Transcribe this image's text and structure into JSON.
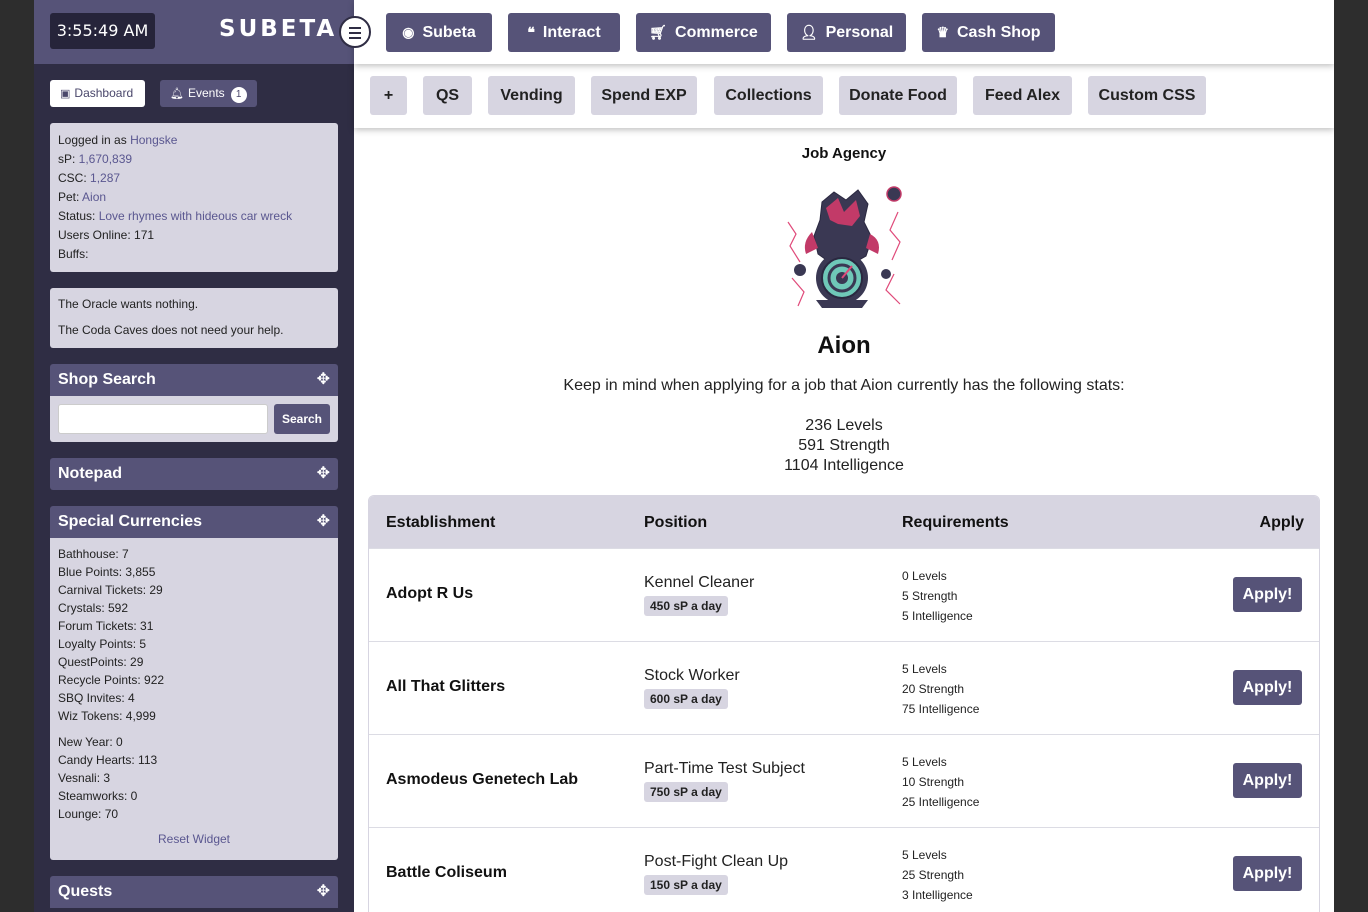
{
  "header": {
    "clock": "3:55:49 AM",
    "logo": "SUBETA"
  },
  "nav": [
    {
      "label": "Subeta",
      "icon": "compass-icon"
    },
    {
      "label": "Interact",
      "icon": "chat-bubbles-icon"
    },
    {
      "label": "Commerce",
      "icon": "cart-icon"
    },
    {
      "label": "Personal",
      "icon": "user-icon"
    },
    {
      "label": "Cash Shop",
      "icon": "crown-icon"
    }
  ],
  "subnav": [
    "+",
    "QS",
    "Vending",
    "Spend EXP",
    "Collections",
    "Donate Food",
    "Feed Alex",
    "Custom CSS"
  ],
  "sidebar": {
    "dashboard_label": "Dashboard",
    "events_label": "Events",
    "events_count": "1",
    "info": {
      "logged_in_label": "Logged in as ",
      "username": "Hongske",
      "sp_label": "sP: ",
      "sp_value": "1,670,839",
      "csc_label": "CSC: ",
      "csc_value": "1,287",
      "pet_label": "Pet: ",
      "pet_value": "Aion",
      "status_label": "Status: ",
      "status_value": "Love rhymes with hideous car wreck",
      "users_online": "Users Online: 171",
      "buffs": "Buffs:"
    },
    "oracle": [
      "The Oracle wants nothing.",
      "The Coda Caves does not need your help."
    ],
    "shop_search": {
      "title": "Shop Search",
      "button": "Search",
      "value": ""
    },
    "notepad_title": "Notepad",
    "currencies": {
      "title": "Special Currencies",
      "group1": [
        "Bathhouse: 7",
        "Blue Points: 3,855",
        "Carnival Tickets: 29",
        "Crystals: 592",
        "Forum Tickets: 31",
        "Loyalty Points: 5",
        "QuestPoints: 29",
        "Recycle Points: 922",
        "SBQ Invites: 4",
        "Wiz Tokens: 4,999"
      ],
      "group2": [
        "New Year: 0",
        "Candy Hearts: 113",
        "Vesnali: 3",
        "Steamworks: 0",
        "Lounge: 70"
      ],
      "reset": "Reset Widget"
    },
    "quests_title": "Quests"
  },
  "main": {
    "title": "Job Agency",
    "pet_name": "Aion",
    "intro": "Keep in mind when applying for a job that Aion currently has the following stats:",
    "stats": [
      "236 Levels",
      "591 Strength",
      "1104 Intelligence"
    ],
    "columns": [
      "Establishment",
      "Position",
      "Requirements",
      "Apply"
    ],
    "jobs": [
      {
        "establishment": "Adopt R Us",
        "position": "Kennel Cleaner",
        "pay": "450 sP a day",
        "req": [
          "0 Levels",
          "5 Strength",
          "5 Intelligence"
        ],
        "apply": "Apply!"
      },
      {
        "establishment": "All That Glitters",
        "position": "Stock Worker",
        "pay": "600 sP a day",
        "req": [
          "5 Levels",
          "20 Strength",
          "75 Intelligence"
        ],
        "apply": "Apply!"
      },
      {
        "establishment": "Asmodeus Genetech Lab",
        "position": "Part-Time Test Subject",
        "pay": "750 sP a day",
        "req": [
          "5 Levels",
          "10 Strength",
          "25 Intelligence"
        ],
        "apply": "Apply!"
      },
      {
        "establishment": "Battle Coliseum",
        "position": "Post-Fight Clean Up",
        "pay": "150 sP a day",
        "req": [
          "5 Levels",
          "25 Strength",
          "3 Intelligence"
        ],
        "apply": "Apply!"
      }
    ]
  },
  "colors": {
    "accent": "#565378",
    "sidebar": "#2f2d44",
    "panel": "#d7d5e1"
  }
}
